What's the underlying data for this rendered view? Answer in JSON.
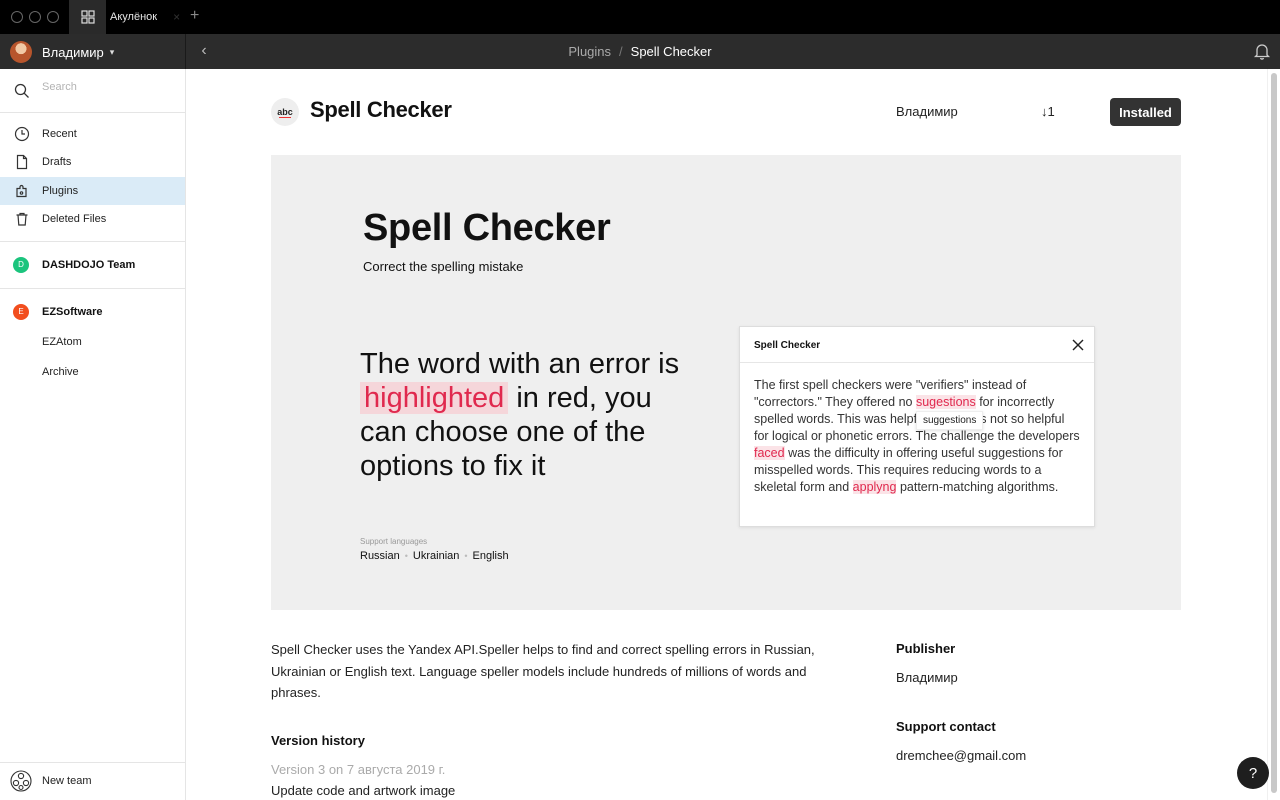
{
  "tabs": {
    "document_tab": "Акулёнок",
    "close_glyph": "×",
    "add_glyph": "+"
  },
  "header": {
    "user_name": "Владимир",
    "back_glyph": "‹",
    "breadcrumb": [
      "Plugins",
      "Spell Checker"
    ],
    "breadcrumb_sep": "/"
  },
  "sidebar": {
    "search_placeholder": "Search",
    "items": [
      {
        "label": "Recent",
        "icon": "clock-icon"
      },
      {
        "label": "Drafts",
        "icon": "file-icon"
      },
      {
        "label": "Plugins",
        "icon": "plugin-icon"
      },
      {
        "label": "Deleted Files",
        "icon": "trash-icon"
      }
    ],
    "teams": [
      {
        "initial": "D",
        "label": "DASHDOJO Team",
        "color": "#1bc47d"
      },
      {
        "initial": "E",
        "label": "EZSoftware",
        "color": "#f24e1e",
        "projects": [
          "EZAtom",
          "Archive"
        ]
      }
    ],
    "new_team_label": "New team"
  },
  "plugin": {
    "icon_text": "abc",
    "title": "Spell Checker",
    "author": "Владимир",
    "installs": "↓1",
    "installed_label": "Installed",
    "cover": {
      "title": "Spell Checker",
      "subtitle": "Correct the spelling mistake",
      "desc_before": "The word with an error is ",
      "desc_highlight": "highlighted",
      "desc_after": " in red, you can choose one of the options to fix it",
      "languages_caption": "Support languages",
      "languages": [
        "Russian",
        "Ukrainian",
        "English"
      ],
      "lang_separator": "•",
      "panel": {
        "title": "Spell Checker",
        "t1": "The first spell checkers were \"verifiers\" instead of \"correctors.\" They offered no ",
        "e1": "sugestions",
        "t2": " for incorrectly spelled words. This was helpful, but it was not so helpful for logical or phonetic errors. The challenge the developers ",
        "e2": "faced",
        "t3": " was the difficulty in offering useful suggestions for misspelled words. This requires reducing words to a skeletal form and ",
        "e3": "applyng",
        "t4": " pattern-matching algorithms.",
        "tooltip": "suggestions"
      }
    },
    "description": "Spell Checker uses the Yandex API.Speller helps to find and correct spelling errors in Russian, Ukrainian or English text. Language speller models include hundreds of millions of words and phrases.",
    "version_heading": "Version history",
    "version_line": "Version 3 on 7 августа 2019 г.",
    "version_note": "Update code and artwork image",
    "publisher_label": "Publisher",
    "publisher_value": "Владимир",
    "support_label": "Support contact",
    "support_value": "dremchee@gmail.com"
  },
  "help_label": "?",
  "colors": {
    "accent_active": "#daebf7",
    "error_red": "#e0294e",
    "error_bg": "#f5d6da",
    "dark_bar": "#2c2c2c"
  }
}
